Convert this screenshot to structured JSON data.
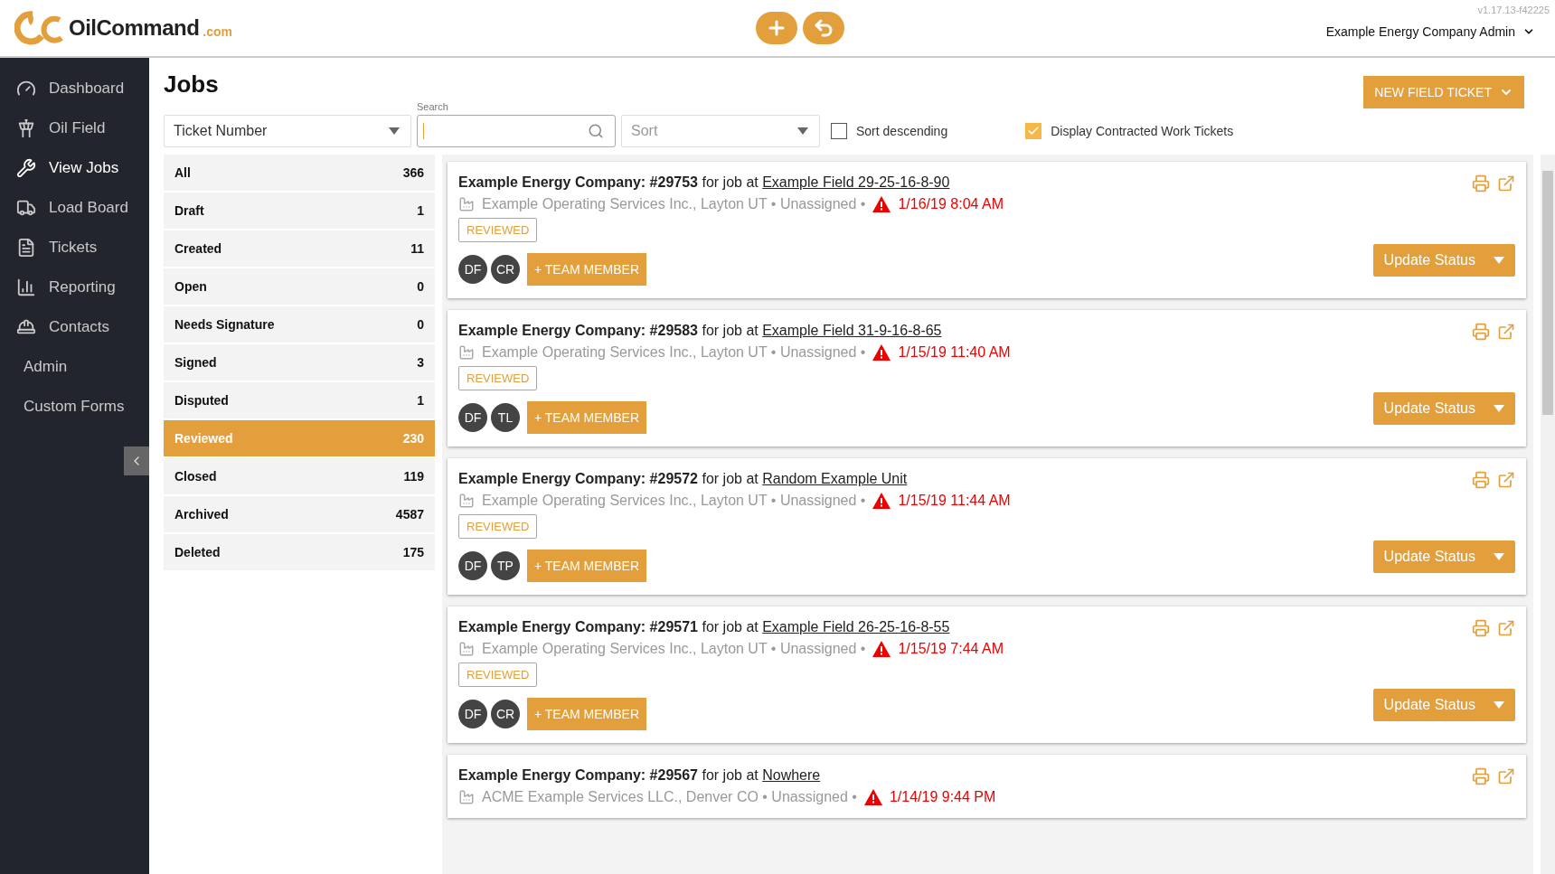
{
  "header": {
    "brand": "OilCommand",
    "brand_suffix": ".com",
    "version": "v1.17.13-f42225",
    "account": "Example Energy Company Admin"
  },
  "sidebar": {
    "items": [
      {
        "label": "Dashboard",
        "selected": false
      },
      {
        "label": "Oil Field",
        "selected": false
      },
      {
        "label": "View Jobs",
        "selected": true
      },
      {
        "label": "Load Board",
        "selected": false
      },
      {
        "label": "Tickets",
        "selected": false
      },
      {
        "label": "Reporting",
        "selected": false
      },
      {
        "label": "Contacts",
        "selected": false
      },
      {
        "label": "Admin",
        "selected": false
      },
      {
        "label": "Custom Forms",
        "selected": false
      }
    ]
  },
  "page": {
    "title": "Jobs",
    "new_button": "NEW FIELD TICKET"
  },
  "toolbar": {
    "field_select": "Ticket Number",
    "search_label": "Search",
    "sort_placeholder": "Sort",
    "sort_descending": {
      "label": "Sort descending",
      "checked": false
    },
    "contracted": {
      "label": "Display Contracted Work Tickets",
      "checked": true
    }
  },
  "filters": [
    {
      "label": "All",
      "count": "366",
      "selected": false
    },
    {
      "label": "Draft",
      "count": "1",
      "selected": false
    },
    {
      "label": "Created",
      "count": "11",
      "selected": false
    },
    {
      "label": "Open",
      "count": "0",
      "selected": false
    },
    {
      "label": "Needs Signature",
      "count": "0",
      "selected": false
    },
    {
      "label": "Signed",
      "count": "3",
      "selected": false
    },
    {
      "label": "Disputed",
      "count": "1",
      "selected": false
    },
    {
      "label": "Reviewed",
      "count": "230",
      "selected": true
    },
    {
      "label": "Closed",
      "count": "119",
      "selected": false
    },
    {
      "label": "Archived",
      "count": "4587",
      "selected": false
    },
    {
      "label": "Deleted",
      "count": "175",
      "selected": false
    }
  ],
  "jobs": [
    {
      "title": "Example Energy Company: #29753",
      "connector": "for job at",
      "location": "Example Field 29-25-16-8-90",
      "meta": "Example Operating Services Inc., Layton UT • Unassigned •",
      "date": "1/16/19 8:04 AM",
      "status": "REVIEWED",
      "members": [
        "DF",
        "CR"
      ],
      "add_member": "+ TEAM MEMBER",
      "update": "Update Status"
    },
    {
      "title": "Example Energy Company: #29583",
      "connector": "for job at",
      "location": "Example Field 31-9-16-8-65",
      "meta": "Example Operating Services Inc., Layton UT • Unassigned •",
      "date": "1/15/19 11:40 AM",
      "status": "REVIEWED",
      "members": [
        "DF",
        "TL"
      ],
      "add_member": "+ TEAM MEMBER",
      "update": "Update Status"
    },
    {
      "title": "Example Energy Company: #29572",
      "connector": "for job at",
      "location": "Random Example Unit",
      "meta": "Example Operating Services Inc., Layton UT • Unassigned •",
      "date": "1/15/19 11:44 AM",
      "status": "REVIEWED",
      "members": [
        "DF",
        "TP"
      ],
      "add_member": "+ TEAM MEMBER",
      "update": "Update Status"
    },
    {
      "title": "Example Energy Company: #29571",
      "connector": "for job at",
      "location": "Example Field 26-25-16-8-55",
      "meta": "Example Operating Services Inc., Layton UT • Unassigned •",
      "date": "1/15/19 7:44 AM",
      "status": "REVIEWED",
      "members": [
        "DF",
        "CR"
      ],
      "add_member": "+ TEAM MEMBER",
      "update": "Update Status"
    },
    {
      "title": "Example Energy Company: #29567",
      "connector": "for job at",
      "location": "Nowhere",
      "meta": "ACME Example Services LLC., Denver CO • Unassigned •",
      "date": "1/14/19 9:44 PM"
    }
  ]
}
